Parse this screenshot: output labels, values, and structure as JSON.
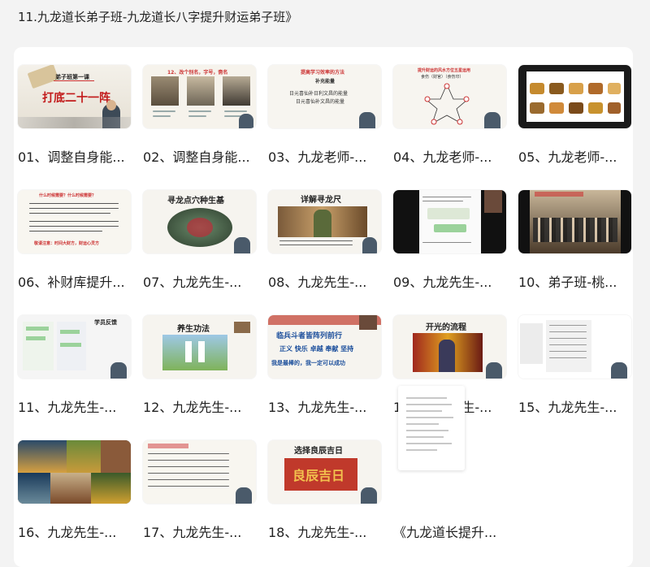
{
  "page": {
    "title": "11.九龙道长弟子班-九龙道长八字提升财运弟子班》"
  },
  "items": [
    {
      "title": "01、调整自身能...",
      "thumb_text": [
        "弟子班第一课",
        "打底二十一阵"
      ]
    },
    {
      "title": "02、调整自身能...",
      "thumb_text": [
        "12、改个别名，字号，斋名"
      ]
    },
    {
      "title": "03、九龙老师-...",
      "thumb_text": [
        "提高学习效率的方法",
        "补充能量",
        "日元喜仙补日利文昌的能量",
        "日元喜仙补文昌的能量"
      ]
    },
    {
      "title": "04、九龙老师-...",
      "thumb_text": [
        "提升财运的风水方位五星运用",
        "食伤（财官）（食伤印）"
      ]
    },
    {
      "title": "05、九龙老师-...",
      "thumb_text": []
    },
    {
      "title": "06、补财库提升...",
      "thumb_text": [
        "什么时候需要？什么时候需要？",
        "敬请注意：时间大财方，财运心灵方"
      ]
    },
    {
      "title": "07、九龙先生-...",
      "thumb_text": [
        "寻龙点穴种生基"
      ]
    },
    {
      "title": "08、九龙先生-...",
      "thumb_text": [
        "详解寻龙尺"
      ]
    },
    {
      "title": "09、九龙先生-...",
      "thumb_text": []
    },
    {
      "title": "10、弟子班-桃...",
      "thumb_text": []
    },
    {
      "title": "11、九龙先生-...",
      "thumb_text": [
        "学员反馈"
      ]
    },
    {
      "title": "12、九龙先生-...",
      "thumb_text": [
        "养生功法"
      ]
    },
    {
      "title": "13、九龙先生-...",
      "thumb_text": [
        "临兵斗者皆阵列前行",
        "正义 快乐 卓越 奉献 坚持",
        "我是最棒的，我一定可以成功"
      ]
    },
    {
      "title": "14、九龙先生-...",
      "thumb_text": [
        "开光的流程"
      ]
    },
    {
      "title": "15、九龙先生-...",
      "thumb_text": []
    },
    {
      "title": "16、九龙先生-...",
      "thumb_text": []
    },
    {
      "title": "17、九龙先生-...",
      "thumb_text": []
    },
    {
      "title": "18、九龙先生-...",
      "thumb_text": [
        "选择良辰吉日",
        "良辰吉日"
      ]
    },
    {
      "title": "《九龙道长提升...",
      "thumb_text": []
    }
  ]
}
